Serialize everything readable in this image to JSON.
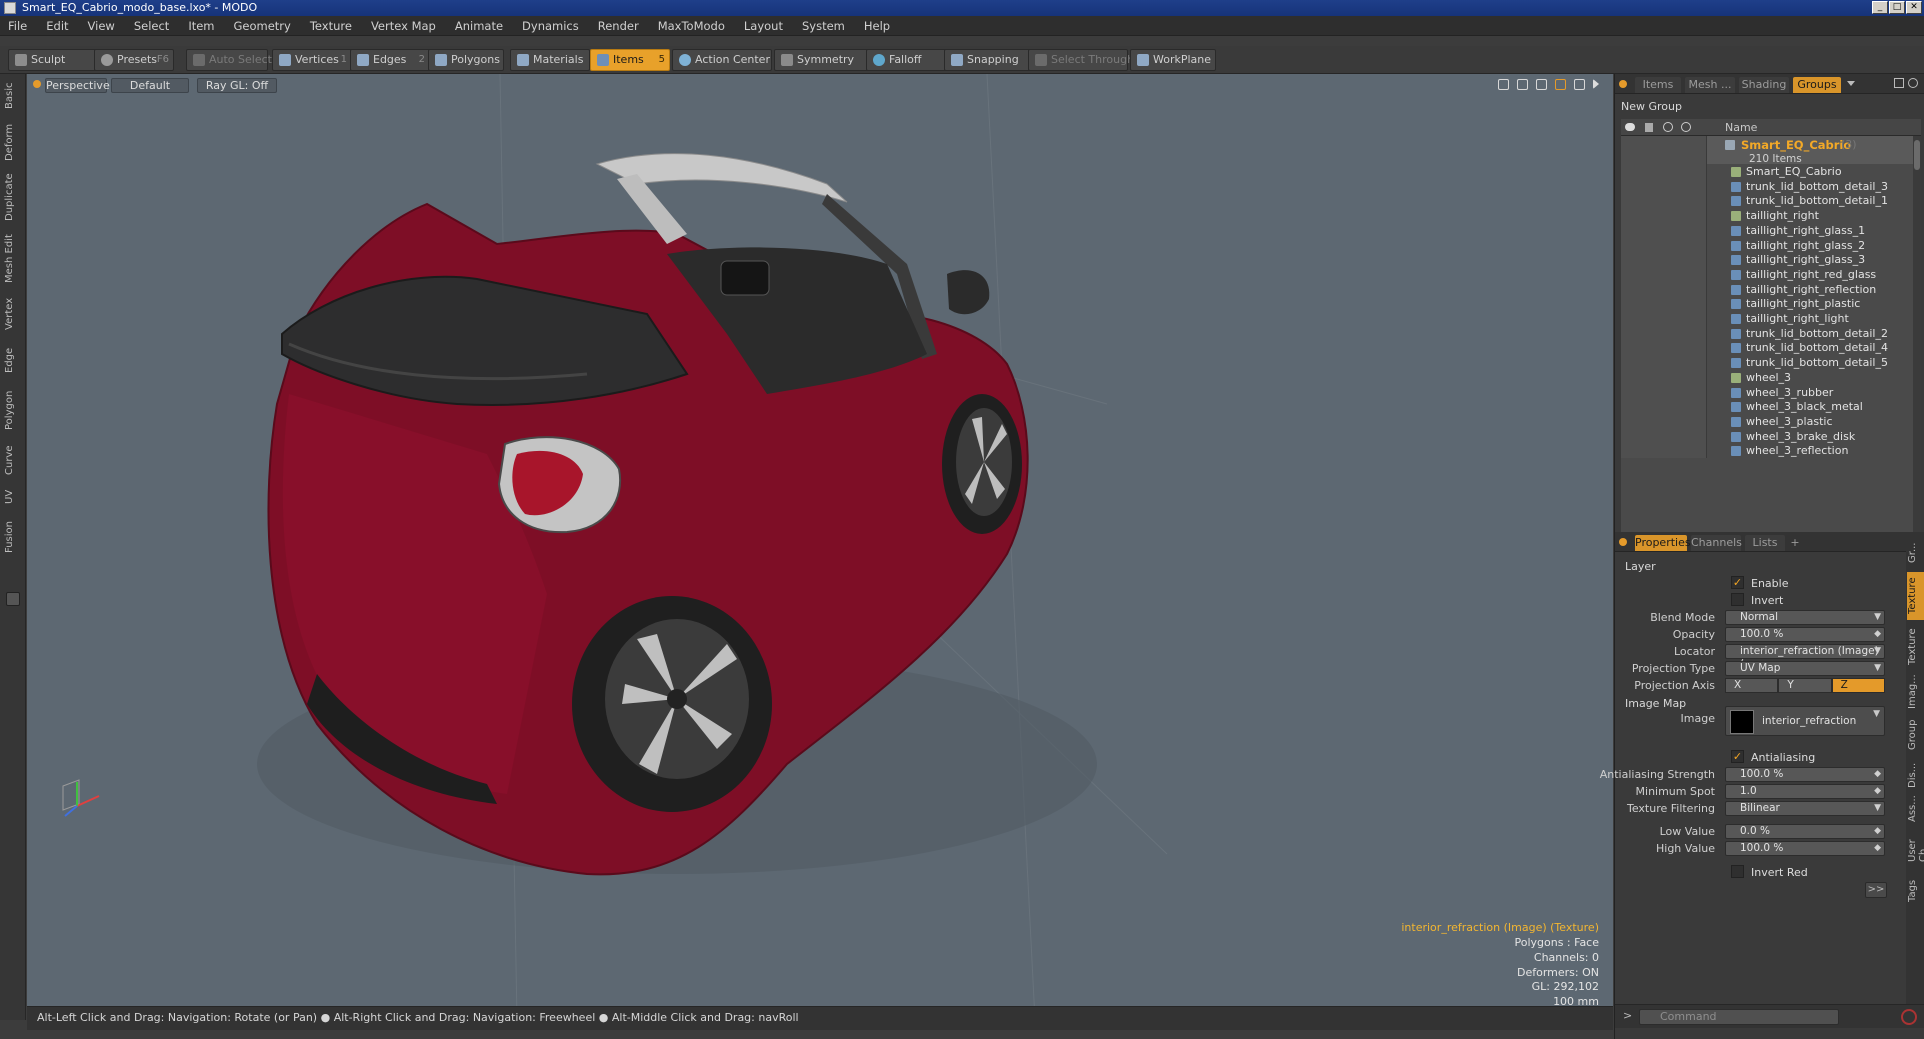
{
  "window": {
    "title": "Smart_EQ_Cabrio_modo_base.lxo* - MODO",
    "controls": [
      "_",
      "□",
      "✕"
    ]
  },
  "menu": [
    "File",
    "Edit",
    "View",
    "Select",
    "Item",
    "Geometry",
    "Texture",
    "Vertex Map",
    "Animate",
    "Dynamics",
    "Render",
    "MaxToModo",
    "Layout",
    "System",
    "Help"
  ],
  "toolbar": {
    "sculpt": "Sculpt",
    "presets": "Presets",
    "presets_key": "F6",
    "auto_select": "Auto Select",
    "vertices": "Vertices",
    "vertices_key": "1",
    "edges": "Edges",
    "edges_key": "2",
    "polygons": "Polygons",
    "materials": "Materials",
    "items": "Items",
    "items_key": "5",
    "action_center": "Action Center",
    "symmetry": "Symmetry",
    "falloff": "Falloff",
    "snapping": "Snapping",
    "select_through": "Select Through",
    "workplane": "WorkPlane"
  },
  "left_tabs": [
    "Basic",
    "Deform",
    "Duplicate",
    "Mesh Edit",
    "Vertex",
    "Edge",
    "Polygon",
    "Curve",
    "UV",
    "Fusion"
  ],
  "viewport": {
    "view": "Perspective",
    "shading": "Default",
    "raygl": "Ray GL: Off",
    "hud": {
      "selection": "interior_refraction (Image) (Texture)",
      "polygons": "Polygons : Face",
      "channels": "Channels: 0",
      "deformers": "Deformers: ON",
      "gl": "GL: 292,102",
      "scale": "100 mm"
    }
  },
  "status": "Alt-Left Click and Drag: Navigation: Rotate (or Pan) ● Alt-Right Click and Drag: Navigation: Freewheel ● Alt-Middle Click and Drag: navRoll",
  "groups_panel": {
    "tabs": [
      "Items",
      "Mesh ...",
      "Shading",
      "Groups"
    ],
    "active_tab": "Groups",
    "new_group": "New Group",
    "column_name": "Name",
    "group": {
      "name": "Smart_EQ_Cabrio",
      "count": "(3)",
      "sub": "210 Items"
    },
    "items": [
      "Smart_EQ_Cabrio",
      "trunk_lid_bottom_detail_3",
      "trunk_lid_bottom_detail_1",
      "taillight_right",
      "taillight_right_glass_1",
      "taillight_right_glass_2",
      "taillight_right_glass_3",
      "taillight_right_red_glass",
      "taillight_right_reflection",
      "taillight_right_plastic",
      "taillight_right_light",
      "trunk_lid_bottom_detail_2",
      "trunk_lid_bottom_detail_4",
      "trunk_lid_bottom_detail_5",
      "wheel_3",
      "wheel_3_rubber",
      "wheel_3_black_metal",
      "wheel_3_plastic",
      "wheel_3_brake_disk",
      "wheel_3_reflection"
    ]
  },
  "properties": {
    "tabs": [
      "Properties",
      "Channels",
      "Lists",
      "+"
    ],
    "layer_section": "Layer",
    "enable": "Enable",
    "invert": "Invert",
    "blend_mode_label": "Blend Mode",
    "blend_mode": "Normal",
    "opacity_label": "Opacity",
    "opacity": "100.0 %",
    "locator_label": "Locator",
    "locator": "interior_refraction (Image) ( ...",
    "projection_type_label": "Projection Type",
    "projection_type": "UV Map",
    "projection_axis_label": "Projection Axis",
    "axes": [
      "X",
      "Y",
      "Z"
    ],
    "axis_active": "Z",
    "image_map_section": "Image Map",
    "image_label": "Image",
    "image": "interior_refraction",
    "antialiasing": "Antialiasing",
    "aa_strength_label": "Antialiasing Strength",
    "aa_strength": "100.0 %",
    "min_spot_label": "Minimum Spot",
    "min_spot": "1.0",
    "tex_filter_label": "Texture Filtering",
    "tex_filter": "Bilinear",
    "low_label": "Low Value",
    "low": "0.0 %",
    "high_label": "High Value",
    "high": "100.0 %",
    "invert_red": "Invert Red",
    "more": ">>"
  },
  "right_tabs": [
    "Gr...",
    "Texture ...",
    "Texture ...",
    "Imag...",
    "Group ...",
    "Dis...",
    "Ass...",
    "User Ch...",
    "Tags"
  ],
  "command_placeholder": "Command"
}
